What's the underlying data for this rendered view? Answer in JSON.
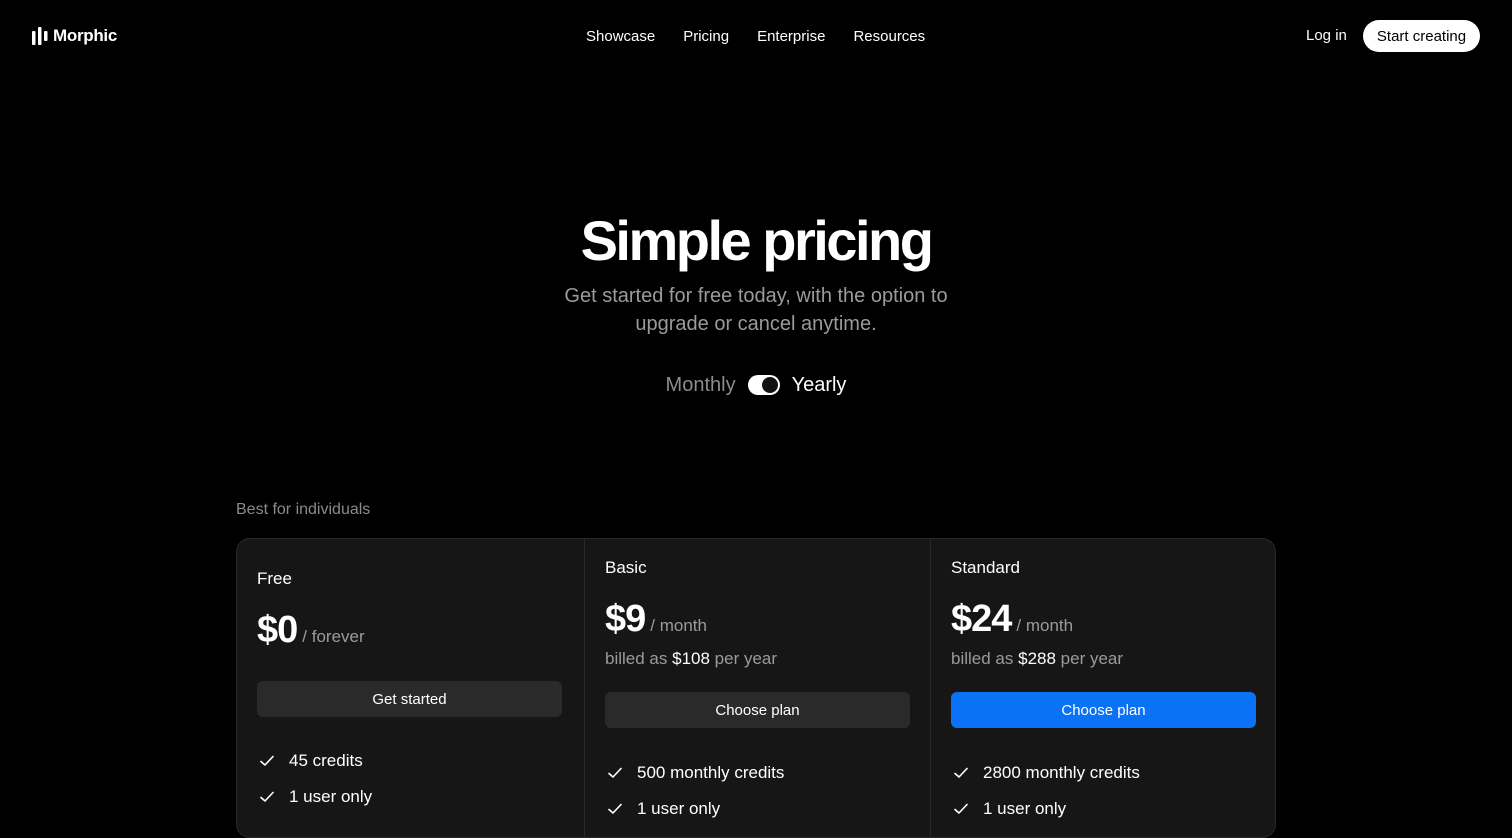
{
  "brand": {
    "name": "Morphic"
  },
  "nav": {
    "links": [
      "Showcase",
      "Pricing",
      "Enterprise",
      "Resources"
    ],
    "login": "Log in",
    "cta": "Start creating"
  },
  "hero": {
    "title": "Simple pricing",
    "subtitle": "Get started for free today, with the option to upgrade or cancel anytime."
  },
  "billing_toggle": {
    "monthly_label": "Monthly",
    "yearly_label": "Yearly",
    "selected": "Yearly"
  },
  "section_label": "Best for individuals",
  "plans": [
    {
      "name": "Free",
      "price": "$0",
      "period": "/ forever",
      "button": "Get started",
      "features": [
        "45 credits",
        "1 user only"
      ]
    },
    {
      "name": "Basic",
      "price": "$9",
      "period": "/ month",
      "billed_prefix": "billed as",
      "billed_amount": "$108",
      "billed_suffix": "per year",
      "button": "Choose plan",
      "features": [
        "500 monthly credits",
        "1 user only"
      ]
    },
    {
      "name": "Standard",
      "price": "$24",
      "period": "/ month",
      "billed_prefix": "billed as",
      "billed_amount": "$288",
      "billed_suffix": "per year",
      "button": "Choose plan",
      "features": [
        "2800 monthly credits",
        "1 user only"
      ]
    }
  ],
  "icons": {
    "logo": "morphic-logo-icon",
    "check": "check-icon"
  },
  "colors": {
    "background": "#000000",
    "card": "#161616",
    "muted_text": "#9b9b9b",
    "primary_button": "#0a72f5",
    "secondary_button": "#2a2a2a"
  }
}
